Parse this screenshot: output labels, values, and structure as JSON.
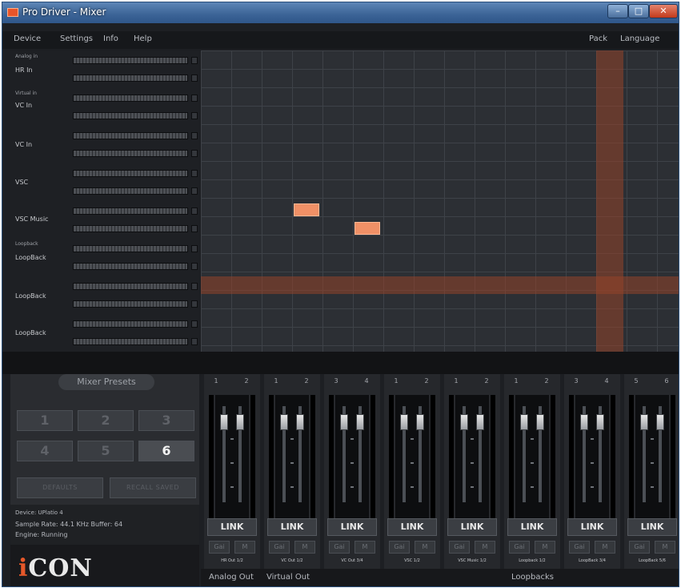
{
  "window": {
    "title": "Pro Driver - Mixer"
  },
  "menu": {
    "left": [
      "Device",
      "Settings",
      "Info",
      "Help"
    ],
    "right": [
      "Pack",
      "Language"
    ]
  },
  "inputs": [
    {
      "group": "Analog in",
      "label": "HR In"
    },
    {
      "group": "Virtual in",
      "label": "VC In"
    },
    {
      "group": "",
      "label": "VC In"
    },
    {
      "group": "",
      "label": "VSC"
    },
    {
      "group": "",
      "label": "VSC Music"
    },
    {
      "group": "Loopback",
      "label": "LoopBack"
    },
    {
      "group": "",
      "label": "LoopBack"
    },
    {
      "group": "",
      "label": "LoopBack"
    }
  ],
  "presets": {
    "title": "Mixer Presets",
    "buttons": [
      "1",
      "2",
      "3",
      "4",
      "5",
      "6"
    ],
    "active": "6",
    "defaults_label": "DEFAULTS",
    "recall_label": "RECALL SAVED"
  },
  "status": {
    "device": "Device: UPlatio 4",
    "rate": "Sample Rate: 44.1 KHz  Buffer: 64",
    "engine": "Engine: Running"
  },
  "logo": {
    "i": "i",
    "rest": "CON"
  },
  "outputs": [
    {
      "nums": [
        "1",
        "2"
      ],
      "name": "HR Out 1/2"
    },
    {
      "nums": [
        "1",
        "2"
      ],
      "name": "VC Out 1/2"
    },
    {
      "nums": [
        "3",
        "4"
      ],
      "name": "VC Out 3/4"
    },
    {
      "nums": [
        "1",
        "2"
      ],
      "name": "VSC 1/2"
    },
    {
      "nums": [
        "1",
        "2"
      ],
      "name": "VSC Music 1/2"
    },
    {
      "nums": [
        "1",
        "2"
      ],
      "name": "Loopback 1/2"
    },
    {
      "nums": [
        "3",
        "4"
      ],
      "name": "LoopBack 3/4"
    },
    {
      "nums": [
        "5",
        "6"
      ],
      "name": "LoopBack 5/6"
    }
  ],
  "strip_buttons": {
    "link": "LINK",
    "gain": "Gai",
    "mute": "M"
  },
  "groups": [
    "Analog Out",
    "Virtual Out",
    "Loopbacks"
  ]
}
